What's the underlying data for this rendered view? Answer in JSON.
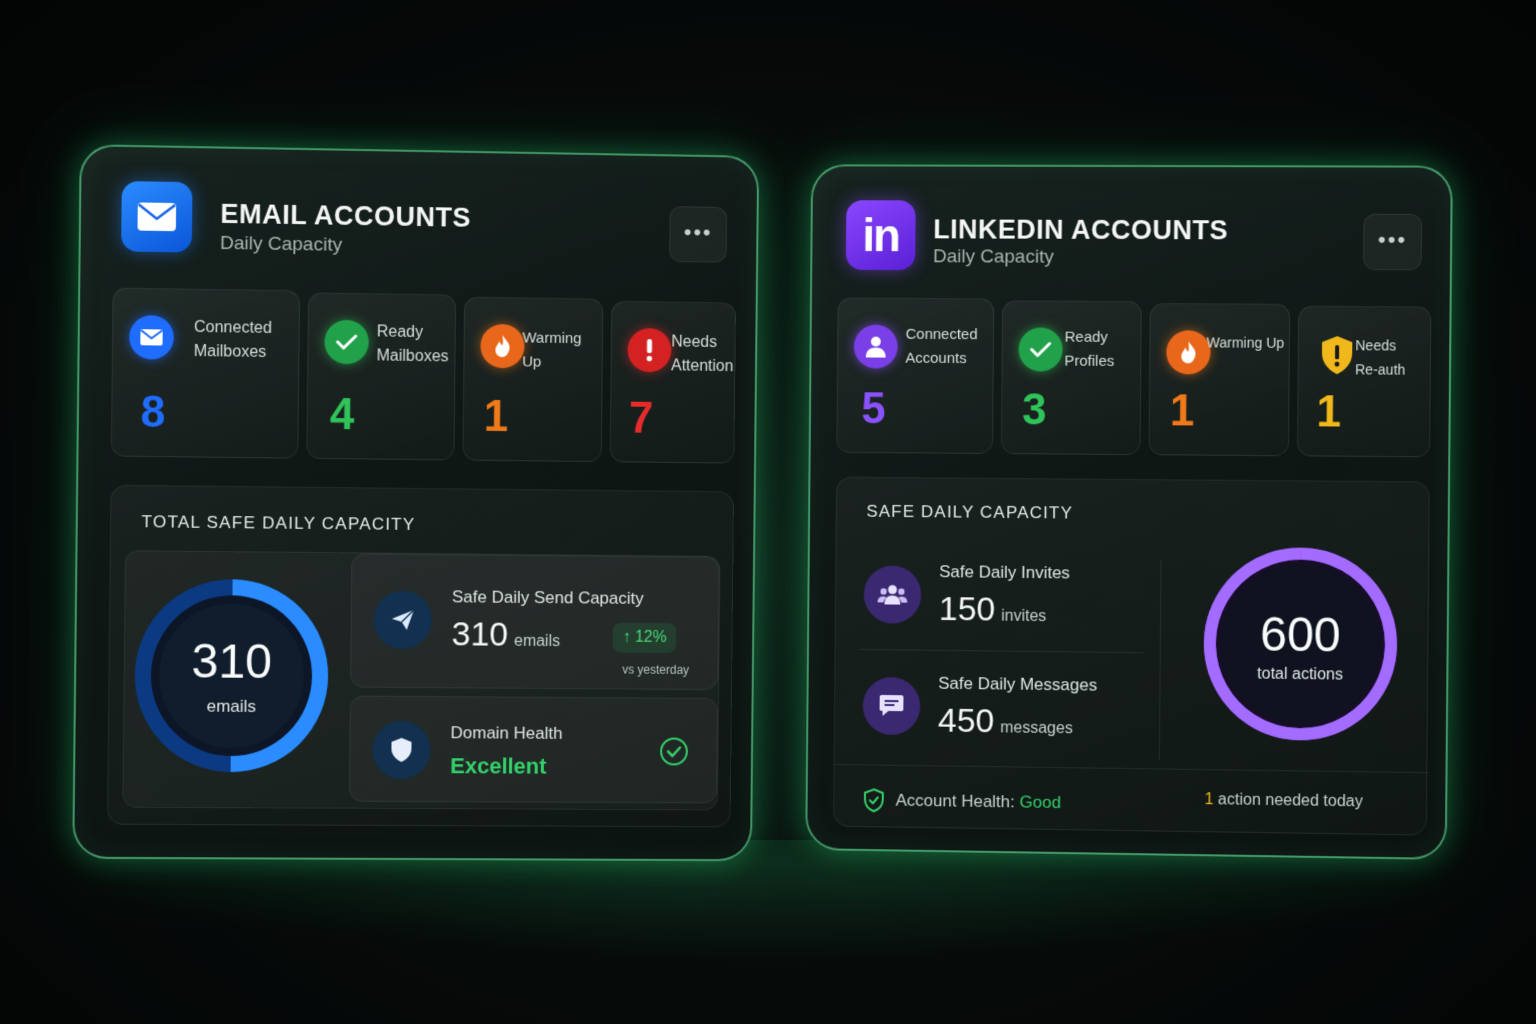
{
  "email": {
    "title": "EMAIL ACCOUNTS",
    "subtitle": "Daily Capacity",
    "more": "•••",
    "stats": [
      {
        "label1": "Connected",
        "label2": "Mailboxes",
        "value": "8",
        "color": "#1f6dff",
        "icon": "envelope-icon"
      },
      {
        "label1": "Ready",
        "label2": "Mailboxes",
        "value": "4",
        "color": "#2fc35a",
        "icon": "checkmark-icon"
      },
      {
        "label1": "Warming Up",
        "label2": "",
        "value": "1",
        "color": "#f07a1a",
        "icon": "flame-icon"
      },
      {
        "label1": "Needs",
        "label2": "Attention",
        "value": "7",
        "color": "#e62b2b",
        "icon": "exclamation-icon"
      }
    ],
    "capacity_title": "TOTAL SAFE DAILY CAPACITY",
    "donut_value": "310",
    "donut_label": "emails",
    "send_label": "Safe Daily Send Capacity",
    "send_value": "310",
    "send_unit": "emails",
    "trend": "12%",
    "trend_note": "vs yesterday",
    "domain_label": "Domain Health",
    "domain_value": "Excellent",
    "accent": "#2a8cff"
  },
  "linkedin": {
    "title": "LINKEDIN ACCOUNTS",
    "subtitle": "Daily Capacity",
    "logo": "in",
    "more": "•••",
    "stats": [
      {
        "label1": "Connected",
        "label2": "Accounts",
        "value": "5",
        "color": "#8a52ff",
        "icon": "user-icon"
      },
      {
        "label1": "Ready",
        "label2": "Profiles",
        "value": "3",
        "color": "#2fc35a",
        "icon": "checkmark-icon"
      },
      {
        "label1": "Warming Up",
        "label2": "",
        "value": "1",
        "color": "#f07a1a",
        "icon": "flame-icon"
      },
      {
        "label1": "Needs",
        "label2": "Re-auth",
        "value": "1",
        "color": "#f0b81a",
        "icon": "shield-warning-icon"
      }
    ],
    "capacity_title": "SAFE DAILY CAPACITY",
    "invites_label": "Safe Daily Invites",
    "invites_value": "150",
    "invites_unit": "invites",
    "messages_label": "Safe Daily Messages",
    "messages_value": "450",
    "messages_unit": "messages",
    "donut_value": "600",
    "donut_label": "total actions",
    "health_label": "Account Health:",
    "health_value": "Good",
    "action_count": "1",
    "action_text": "action needed today",
    "accent": "#9b5cff"
  }
}
